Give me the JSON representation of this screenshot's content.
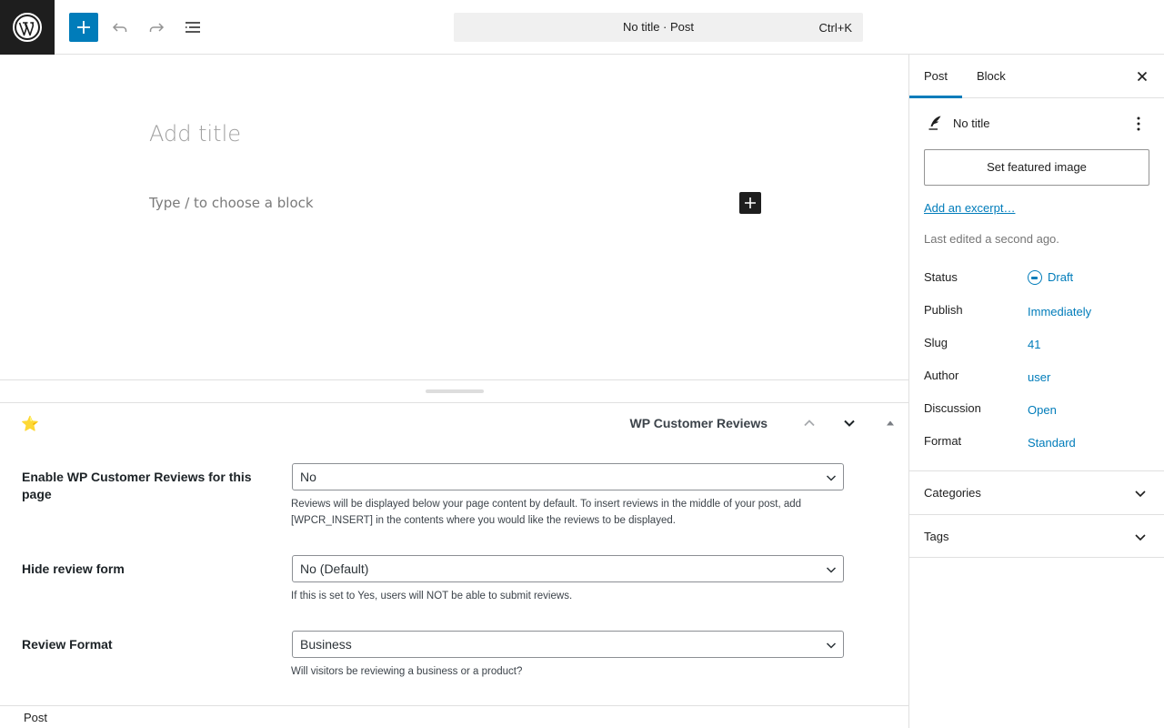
{
  "topbar": {
    "logo_icon": "wordpress-logo-icon",
    "command_title": "No title · Post",
    "command_shortcut": "Ctrl+K",
    "accent": "#007cba"
  },
  "editor": {
    "title_placeholder": "Add title",
    "block_placeholder": "Type / to choose a block"
  },
  "metabox": {
    "title": "WP Customer Reviews",
    "rows": [
      {
        "label": "Enable WP Customer Reviews for this page",
        "value": "No",
        "description": "Reviews will be displayed below your page content by default. To insert reviews in the middle of your post, add [WPCR_INSERT] in the contents where you would like the reviews to be displayed."
      },
      {
        "label": "Hide review form",
        "value": "No (Default)",
        "description": "If this is set to Yes, users will NOT be able to submit reviews."
      },
      {
        "label": "Review Format",
        "value": "Business",
        "description": "Will visitors be reviewing a business or a product?"
      }
    ]
  },
  "statusbar": {
    "breadcrumb": "Post"
  },
  "sidebar": {
    "tabs": [
      {
        "label": "Post"
      },
      {
        "label": "Block"
      }
    ],
    "post_title": "No title",
    "featured_image_label": "Set featured image",
    "excerpt_link": "Add an excerpt…",
    "last_edited": "Last edited a second ago.",
    "fields": [
      {
        "label": "Status",
        "value": "Draft"
      },
      {
        "label": "Publish",
        "value": "Immediately"
      },
      {
        "label": "Slug",
        "value": "41"
      },
      {
        "label": "Author",
        "value": "user"
      },
      {
        "label": "Discussion",
        "value": "Open"
      },
      {
        "label": "Format",
        "value": "Standard"
      }
    ],
    "panels": [
      {
        "label": "Categories"
      },
      {
        "label": "Tags"
      }
    ]
  }
}
